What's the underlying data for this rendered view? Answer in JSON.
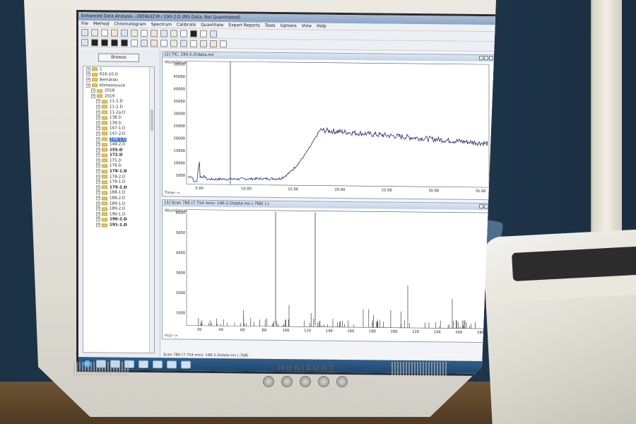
{
  "window": {
    "title": "Enhanced Data Analysis - DEFAULT.M / 190-2.D     [MS Data: Not Quantitated]"
  },
  "menu": [
    "File",
    "Method",
    "Chromatogram",
    "Spectrum",
    "Calibrate",
    "Quantitate",
    "Export Reports",
    "Tools",
    "Options",
    "View",
    "Help"
  ],
  "browser": {
    "browse_label": "Browse",
    "tree": [
      {
        "label": "1",
        "level": 0,
        "bold": false
      },
      {
        "label": "616-10.D",
        "level": 0,
        "bold": false
      },
      {
        "label": "Bematski",
        "level": 0,
        "bold": false
      },
      {
        "label": "Klimentovich",
        "level": 0,
        "bold": false
      },
      {
        "label": "2018",
        "level": 1,
        "bold": false
      },
      {
        "label": "2019",
        "level": 1,
        "bold": false
      },
      {
        "label": "11-1.D",
        "level": 2,
        "bold": false
      },
      {
        "label": "11-2.D",
        "level": 2,
        "bold": false
      },
      {
        "label": "11-2a.D",
        "level": 2,
        "bold": false
      },
      {
        "label": "138.D",
        "level": 2,
        "bold": false
      },
      {
        "label": "139.D",
        "level": 2,
        "bold": false
      },
      {
        "label": "147-1.D",
        "level": 2,
        "bold": false
      },
      {
        "label": "147-2.D",
        "level": 2,
        "bold": false
      },
      {
        "label": "148-1.D",
        "level": 2,
        "bold": false,
        "selected": true
      },
      {
        "label": "148-2.D",
        "level": 2,
        "bold": false
      },
      {
        "label": "155.D",
        "level": 2,
        "bold": true
      },
      {
        "label": "172.D",
        "level": 2,
        "bold": true
      },
      {
        "label": "175.D",
        "level": 2,
        "bold": false
      },
      {
        "label": "176.D",
        "level": 2,
        "bold": false
      },
      {
        "label": "178-1.D",
        "level": 2,
        "bold": true
      },
      {
        "label": "178-2.D",
        "level": 2,
        "bold": false
      },
      {
        "label": "179-1.D",
        "level": 2,
        "bold": false
      },
      {
        "label": "179-2.D",
        "level": 2,
        "bold": true
      },
      {
        "label": "188-1.D",
        "level": 2,
        "bold": false
      },
      {
        "label": "188-2.D",
        "level": 2,
        "bold": false
      },
      {
        "label": "189-1.D",
        "level": 2,
        "bold": false
      },
      {
        "label": "189-2.D",
        "level": 2,
        "bold": false
      },
      {
        "label": "190-1.D",
        "level": 2,
        "bold": false
      },
      {
        "label": "190-2.D",
        "level": 2,
        "bold": true
      },
      {
        "label": "191-1.D",
        "level": 2,
        "bold": true
      }
    ]
  },
  "tic": {
    "title": "[2] TIC: 190-2.D\\data.ms",
    "y_label": "Abundance",
    "x_label": "Time-->",
    "y_ticks": [
      "50000",
      "45000",
      "40000",
      "35000",
      "30000",
      "25000",
      "20000",
      "15000",
      "10000",
      "5000"
    ],
    "x_ticks": [
      "5.00",
      "10.00",
      "15.00",
      "20.00",
      "25.00",
      "30.00",
      "35.00"
    ]
  },
  "spectrum": {
    "title": "[3] Scan 786 (7.754 min): 190-2.D\\data.ms (-768) (-)",
    "y_label": "Abundance",
    "x_label": "m/z-->",
    "y_ticks": [
      "6000",
      "5000",
      "4000",
      "3000",
      "2000",
      "1000"
    ],
    "x_ticks": [
      "20",
      "40",
      "60",
      "80",
      "100",
      "120",
      "140",
      "160",
      "180",
      "200",
      "220",
      "240",
      "260",
      "280"
    ],
    "status": "Scan 786 (7.754 min): 190-2.D\\data.ms (-768)"
  },
  "monitor": {
    "brand": "HORIZONT"
  },
  "colors": {
    "trace": "#1f2f6a",
    "selection": "#3b73c8",
    "taskbar": "#1f4770"
  }
}
